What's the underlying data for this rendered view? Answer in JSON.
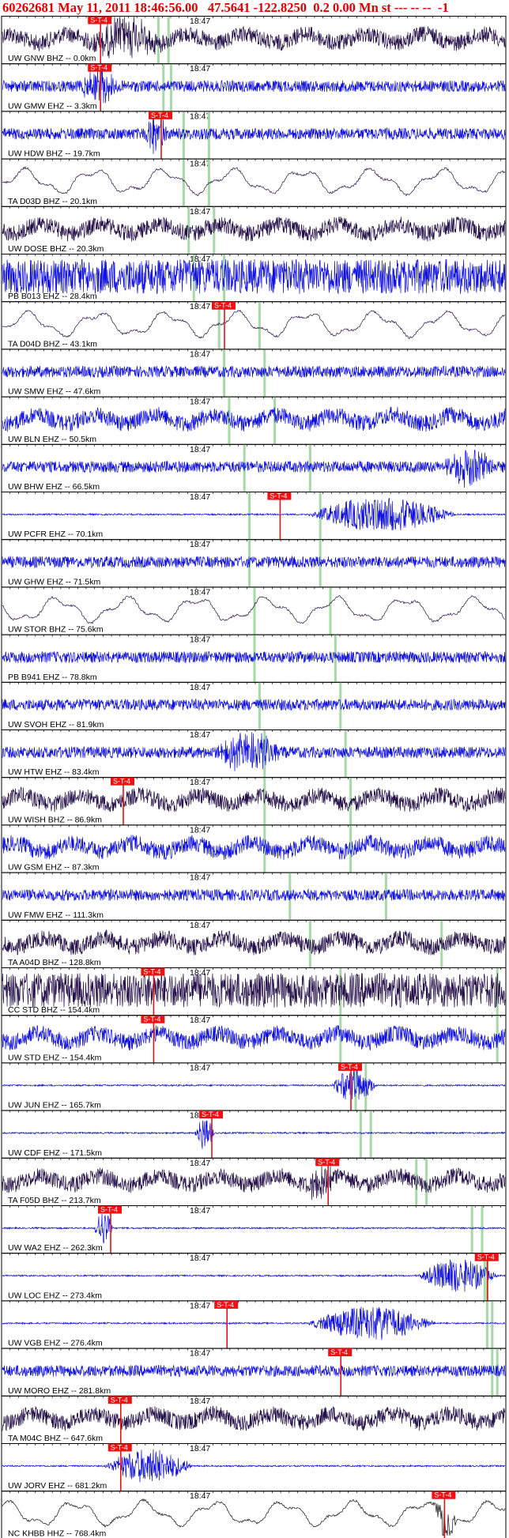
{
  "header": {
    "event_id": "60262681",
    "date": "May 11, 2011",
    "time": "18:46:56.00",
    "lat": "47.5641",
    "lon": "-122.8250",
    "depth": "0.2",
    "mag": "0.00",
    "mag_type": "Mn",
    "extra": "st --- -- --  -1"
  },
  "colors": {
    "accent": "#ff0000",
    "trace_a": "#1010e0",
    "trace_b": "#25104a",
    "trace_c": "#111111",
    "pick_bg": "#ee1111",
    "s_marker": "#a6d9a6"
  },
  "chart_data": {
    "type": "line",
    "title": "",
    "xlabel": "",
    "ylabel": "",
    "time_tick_label": "18:47",
    "pick_label": "S-T-4",
    "traces": [
      {
        "label": "UW GNW BHZ -- 0.0km",
        "color": "b",
        "style": "mixed",
        "pick_t": 0.18,
        "s_ticks": [
          0.31,
          0.33
        ],
        "burst": [
          0.17,
          0.32
        ]
      },
      {
        "label": "UW GMW EHZ -- 3.3km",
        "color": "a",
        "style": "hf",
        "pick_t": 0.18,
        "s_ticks": [
          0.32,
          0.335
        ],
        "burst": [
          0.15,
          0.23
        ]
      },
      {
        "label": "UW HDW BHZ -- 19.7km",
        "color": "a",
        "style": "hf",
        "pick_t": 0.3,
        "s_ticks": [
          0.36,
          0.41
        ],
        "burst": [
          0.28,
          0.33
        ]
      },
      {
        "label": "TA D03D BHZ -- 20.1km",
        "color": "b",
        "style": "lp",
        "pick_t": null,
        "s_ticks": [
          0.36,
          0.41
        ],
        "burst": null
      },
      {
        "label": "UW DOSE BHZ -- 20.3km",
        "color": "b",
        "style": "mixed",
        "pick_t": null,
        "s_ticks": [
          0.37,
          0.42
        ],
        "burst": null
      },
      {
        "label": "PB B013 EHZ -- 28.4km",
        "color": "a",
        "style": "sat",
        "pick_t": null,
        "s_ticks": [
          0.38,
          0.44
        ],
        "burst": null
      },
      {
        "label": "TA D04D BHZ -- 43.1km",
        "color": "b",
        "style": "lp",
        "pick_t": 0.425,
        "s_ticks": [
          0.43,
          0.51
        ],
        "burst": null
      },
      {
        "label": "UW SMW EHZ -- 47.6km",
        "color": "a",
        "style": "hf",
        "pick_t": null,
        "s_ticks": [
          0.44,
          0.52
        ],
        "burst": null
      },
      {
        "label": "UW BLN EHZ -- 50.5km",
        "color": "a",
        "style": "mixed",
        "pick_t": null,
        "s_ticks": [
          0.45,
          0.54
        ],
        "burst": null
      },
      {
        "label": "UW BHW EHZ -- 66.5km",
        "color": "a",
        "style": "hf",
        "pick_t": null,
        "s_ticks": [
          0.48,
          0.61
        ],
        "burst": [
          0.87,
          0.98
        ]
      },
      {
        "label": "UW PCFR EHZ -- 70.1km",
        "color": "a",
        "style": "quiet",
        "pick_t": 0.535,
        "s_ticks": [
          0.49,
          0.63
        ],
        "burst": [
          0.6,
          0.9
        ]
      },
      {
        "label": "UW GHW EHZ -- 71.5km",
        "color": "a",
        "style": "hf",
        "pick_t": null,
        "s_ticks": [
          0.49,
          0.63
        ],
        "burst": null
      },
      {
        "label": "UW STOR BHZ -- 75.6km",
        "color": "b",
        "style": "lp",
        "pick_t": null,
        "s_ticks": [
          0.5,
          0.65
        ],
        "burst": null
      },
      {
        "label": "PB B941 EHZ -- 78.8km",
        "color": "a",
        "style": "hf",
        "pick_t": null,
        "s_ticks": [
          0.5,
          0.66
        ],
        "burst": null
      },
      {
        "label": "UW SVOH EHZ -- 81.9km",
        "color": "a",
        "style": "hf",
        "pick_t": null,
        "s_ticks": [
          0.51,
          0.67
        ],
        "burst": null
      },
      {
        "label": "UW HTW EHZ -- 83.4km",
        "color": "a",
        "style": "hf",
        "pick_t": null,
        "s_ticks": [
          0.52,
          0.68
        ],
        "burst": [
          0.42,
          0.56
        ]
      },
      {
        "label": "UW WISH BHZ -- 86.9km",
        "color": "b",
        "style": "mixed",
        "pick_t": 0.225,
        "s_ticks": [
          0.52,
          0.69
        ],
        "burst": null
      },
      {
        "label": "UW GSM EHZ -- 87.3km",
        "color": "a",
        "style": "mixed",
        "pick_t": null,
        "s_ticks": [
          0.52,
          0.69
        ],
        "burst": null
      },
      {
        "label": "UW FMW EHZ -- 111.3km",
        "color": "a",
        "style": "hf",
        "pick_t": null,
        "s_ticks": [
          0.57,
          0.76
        ],
        "burst": null
      },
      {
        "label": "TA A04D BHZ -- 128.8km",
        "color": "b",
        "style": "mixed",
        "pick_t": null,
        "s_ticks": [
          0.61,
          0.87
        ],
        "burst": null
      },
      {
        "label": "CC STD BHZ -- 154.4km",
        "color": "b",
        "style": "sat",
        "pick_t": 0.285,
        "s_ticks": [
          0.67,
          0.98
        ],
        "burst": null
      },
      {
        "label": "UW STD EHZ -- 154.4km",
        "color": "a",
        "style": "mixed",
        "pick_t": 0.285,
        "s_ticks": [
          0.67,
          0.98
        ],
        "burst": null
      },
      {
        "label": "UW JUN EHZ -- 165.7km",
        "color": "a",
        "style": "quiet",
        "pick_t": 0.675,
        "s_ticks": [
          0.7,
          0.72
        ],
        "burst": [
          0.65,
          0.74
        ]
      },
      {
        "label": "UW CDF EHZ -- 171.5km",
        "color": "a",
        "style": "quiet",
        "pick_t": 0.4,
        "s_ticks": [
          0.71,
          0.73
        ],
        "burst": [
          0.38,
          0.42
        ]
      },
      {
        "label": "TA F05D BHZ -- 213.7km",
        "color": "b",
        "style": "mixed",
        "pick_t": 0.63,
        "s_ticks": [
          0.82,
          0.84
        ],
        "burst": [
          0.6,
          0.66
        ]
      },
      {
        "label": "UW WA2 EHZ -- 262.3km",
        "color": "a",
        "style": "quiet",
        "pick_t": 0.2,
        "s_ticks": [
          0.93,
          0.95
        ],
        "burst": [
          0.18,
          0.22
        ]
      },
      {
        "label": "UW LOC EHZ -- 273.4km",
        "color": "a",
        "style": "quiet",
        "pick_t": 0.945,
        "s_ticks": [
          0.955,
          0.96
        ],
        "burst": [
          0.82,
          0.98
        ]
      },
      {
        "label": "UW VGB EHZ -- 276.4km",
        "color": "a",
        "style": "quiet",
        "pick_t": 0.43,
        "s_ticks": [
          0.96,
          0.97
        ],
        "burst": [
          0.6,
          0.86
        ]
      },
      {
        "label": "UW MORO EHZ -- 281.8km",
        "color": "a",
        "style": "hf",
        "pick_t": 0.655,
        "s_ticks": [
          0.97,
          0.98
        ],
        "burst": null
      },
      {
        "label": "TA M04C BHZ -- 647.6km",
        "color": "b",
        "style": "mixed",
        "pick_t": 0.22,
        "s_ticks": [],
        "burst": null
      },
      {
        "label": "UW JORV EHZ -- 681.2km",
        "color": "a",
        "style": "quiet",
        "pick_t": 0.22,
        "s_ticks": [],
        "burst": [
          0.2,
          0.38
        ]
      },
      {
        "label": "NC KHBB HHZ -- 768.4km",
        "color": "c",
        "style": "lp",
        "pick_t": 0.86,
        "s_ticks": [],
        "burst": [
          0.85,
          0.9
        ]
      }
    ]
  }
}
